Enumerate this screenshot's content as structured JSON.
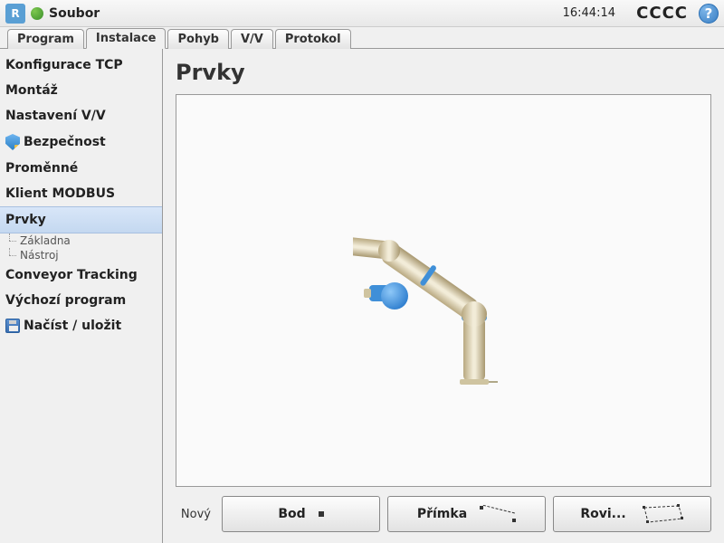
{
  "header": {
    "logo_text": "R",
    "file_menu": "Soubor",
    "clock": "16:44:14",
    "status_text": "CCCC",
    "help_symbol": "?"
  },
  "tabs": [
    {
      "label": "Program",
      "active": false
    },
    {
      "label": "Instalace",
      "active": true
    },
    {
      "label": "Pohyb",
      "active": false
    },
    {
      "label": "V/V",
      "active": false
    },
    {
      "label": "Protokol",
      "active": false
    }
  ],
  "sidebar": {
    "items": [
      {
        "label": "Konfigurace TCP"
      },
      {
        "label": "Montáž"
      },
      {
        "label": "Nastavení V/V"
      },
      {
        "label": "Bezpečnost",
        "icon": "shield"
      },
      {
        "label": "Proměnné"
      },
      {
        "label": "Klient MODBUS"
      },
      {
        "label": "Prvky",
        "selected": true,
        "children": [
          "Základna",
          "Nástroj"
        ]
      },
      {
        "label": "Conveyor Tracking"
      },
      {
        "label": "Výchozí program"
      },
      {
        "label": "Načíst / uložit",
        "icon": "disk"
      }
    ]
  },
  "content": {
    "title": "Prvky",
    "new_label": "Nový",
    "buttons": [
      {
        "label": "Bod",
        "glyph": "point"
      },
      {
        "label": "Přímka",
        "glyph": "line"
      },
      {
        "label": "Rovi...",
        "glyph": "plane"
      }
    ]
  }
}
